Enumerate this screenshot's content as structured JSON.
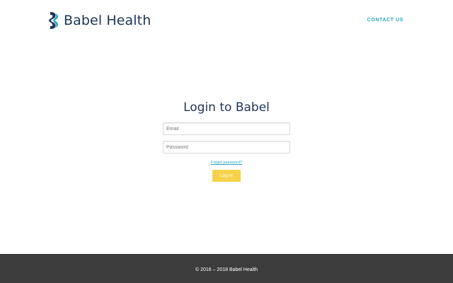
{
  "header": {
    "brand_name": "Babel Health",
    "nav": {
      "contact_label": "CONTACT US"
    }
  },
  "login": {
    "title": "Login to Babel",
    "email_placeholder": "Email",
    "password_placeholder": "Password",
    "forgot_label": "Forgot password?",
    "submit_label": "Log in"
  },
  "footer": {
    "copyright": "© 2016 – 2018 Babel Health"
  },
  "colors": {
    "brand_navy": "#1d3557",
    "brand_teal": "#29a6c2",
    "button_yellow": "#f6d24a",
    "footer_bg": "#3c3c3c"
  }
}
